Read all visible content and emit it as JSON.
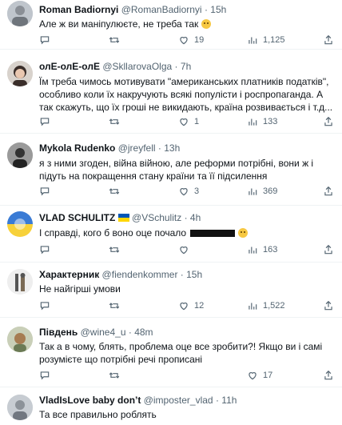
{
  "tweets": [
    {
      "name": "Roman Badiornyi",
      "handle": "@RomanBadiornyi",
      "time": "15h",
      "text": "Але ж ви маніпулюєте, не треба так",
      "replies": "",
      "retweets": "",
      "likes": "19",
      "views": "1,125"
    },
    {
      "name": "олЕ-олЕ-олЕ",
      "handle": "@SkllarovaOlga",
      "time": "7h",
      "text": "Їм треба чимось мотивувати \"американських платників податків\", особливо коли їх накручують всякі популісти і роспропаганда. А так скажуть, що їх гроші не викидають, країна розвивається і т.д...",
      "replies": "",
      "retweets": "",
      "likes": "1",
      "views": "133"
    },
    {
      "name": "Mykola Rudenko",
      "handle": "@jreyfell",
      "time": "13h",
      "text": "я з ними згоден, війна війною, але реформи потрібні, вони ж і підуть на покращення стану країни та її підсилення",
      "replies": "",
      "retweets": "",
      "likes": "3",
      "views": "369"
    },
    {
      "name": "VLAD SCHULITZ",
      "handle": "@VSchulitz",
      "time": "4h",
      "text": "І справді, кого б воно оце почало",
      "replies": "",
      "retweets": "",
      "likes": "",
      "views": "163"
    },
    {
      "name": "Характерник",
      "handle": "@fiendenkommer",
      "time": "15h",
      "text": "Не найгірші умови",
      "replies": "",
      "retweets": "",
      "likes": "12",
      "views": "1,522"
    },
    {
      "name": "Південь",
      "handle": "@wine4_u",
      "time": "48m",
      "text": "Так а в чому, блять, проблема оце все зробити?! Якщо ви і самі розумієте що потрібні речі прописані",
      "replies": "",
      "retweets": "",
      "likes": "17",
      "views": ""
    },
    {
      "name": "VladIsLove baby don’t",
      "handle": "@imposter_vlad",
      "time": "11h",
      "text": "Та все правильно роблять",
      "replies": "",
      "retweets": "",
      "likes": "",
      "views": ""
    }
  ],
  "ui": {
    "dot": "·",
    "more": "···"
  },
  "colors": {
    "accent": "#1d9bf0",
    "muted": "#536471",
    "divider": "#eff3f4"
  }
}
